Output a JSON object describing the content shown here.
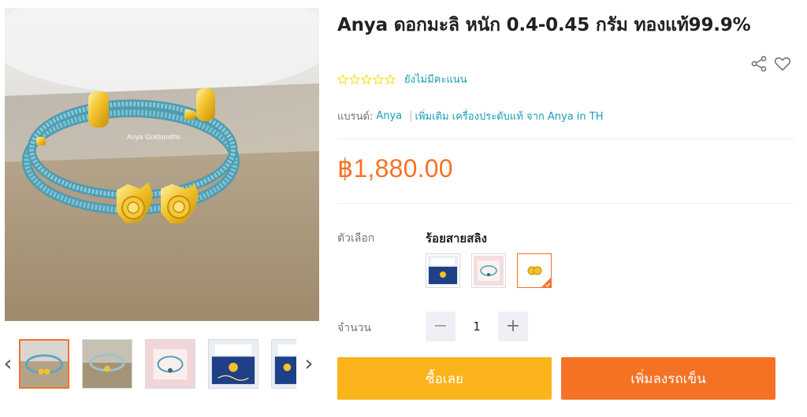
{
  "product": {
    "title": "Anya ดอกมะลิ หนัก 0.4-0.45 กรัม ทองแท้99.9%",
    "image_watermark": "Anya Goldsmiths",
    "rating_text": "ยังไม่มีคะแนน",
    "rating_stars": 0,
    "brand_label": "แบรนด์:",
    "brand_name": "Anya",
    "brand_separator": "|",
    "more_link": "เพิ่มเติม เครื่องประดับแท้ จาก Anya in TH",
    "price": "฿1,880.00"
  },
  "thumbnails": [
    "bracelet-blue-front",
    "bracelet-on-box",
    "bracelet-pink-box",
    "certificate-card",
    "certificate-card-2"
  ],
  "options": {
    "label": "ตัวเลือก",
    "selected_value": "ร้อยสายสลิง",
    "variants": [
      "certificate",
      "pink-box-bracelet",
      "gold-charm"
    ],
    "selected_index": 2
  },
  "quantity": {
    "label": "จำนวน",
    "value": "1",
    "minus": "−",
    "plus": "+"
  },
  "buttons": {
    "buy_now": "ซื้อเลย",
    "add_to_cart": "เพิ่มลงรถเข็น"
  },
  "nav": {
    "prev": "‹",
    "next": "›"
  },
  "colors": {
    "accent": "#f57224",
    "buy": "#fbb41b",
    "link": "#1a9cb7",
    "star_empty": "#fadb14"
  }
}
